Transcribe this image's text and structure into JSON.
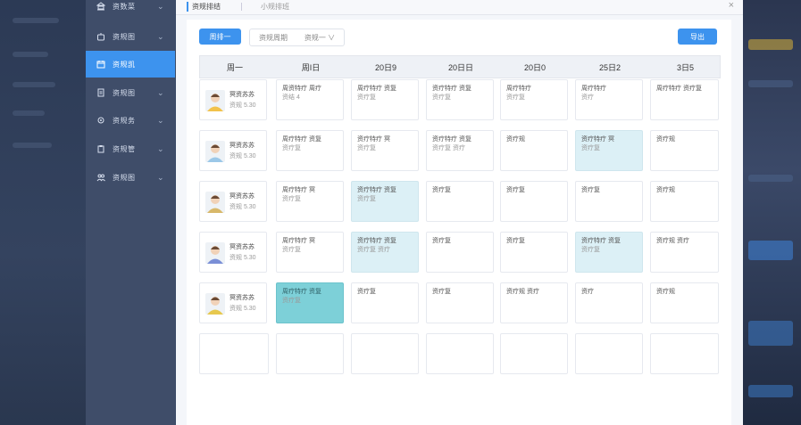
{
  "sidebar": {
    "items": [
      {
        "label": "资数菜",
        "icon": "bank-icon",
        "active": false
      },
      {
        "label": "资规图",
        "icon": "bot-icon",
        "active": false
      },
      {
        "label": "资规凯",
        "icon": "calendar-icon",
        "active": true
      },
      {
        "label": "资规图",
        "icon": "doc-icon",
        "active": false
      },
      {
        "label": "资规务",
        "icon": "settings-icon",
        "active": false
      },
      {
        "label": "资规管",
        "icon": "clipboard-icon",
        "active": false
      },
      {
        "label": "资规图",
        "icon": "people-icon",
        "active": false
      }
    ]
  },
  "topbar": {
    "tab_active": "资规排结",
    "tab_inactive": "小规排班",
    "close": "×"
  },
  "toolbar": {
    "week_button": "周排一",
    "seg_a": "资规周期",
    "seg_b": "资规一 ∨",
    "right_button": "导出"
  },
  "table": {
    "headers": [
      "周一",
      "周I日",
      "20日9",
      "20日日",
      "20日0",
      "25日2",
      "3日5"
    ],
    "rows": [
      {
        "person": {
          "name": "冥资苏苏",
          "meta": "资规 5.30",
          "avatar_color": "#f2c24b"
        },
        "cells": [
          {
            "l1": "周资特疗 周疗",
            "l2": "资结 4",
            "style": "plain"
          },
          {
            "l1": "周疗特疗 资复",
            "l2": "资疗复",
            "style": "plain"
          },
          {
            "l1": "资疗特疗 资复",
            "l2": "资疗复",
            "style": "plain"
          },
          {
            "l1": "周疗特疗",
            "l2": "资疗复",
            "style": "plain"
          },
          {
            "l1": "周疗特疗",
            "l2": "资疗",
            "style": "plain"
          },
          {
            "l1": "周疗特疗 资疗复",
            "l2": "",
            "style": "plain"
          }
        ]
      },
      {
        "person": {
          "name": "冥资苏苏",
          "meta": "资规 5.30",
          "avatar_color": "#9cc8e8"
        },
        "cells": [
          {
            "l1": "周疗特疗 资复",
            "l2": "资疗复",
            "style": "plain"
          },
          {
            "l1": "资疗特疗 冥",
            "l2": "资疗复",
            "style": "plain"
          },
          {
            "l1": "资疗特疗 资复",
            "l2": "资疗复 资疗",
            "style": "plain"
          },
          {
            "l1": "资疗规",
            "l2": "",
            "style": "plain"
          },
          {
            "l1": "资疗特疗 冥",
            "l2": "资疗复",
            "style": "blue"
          },
          {
            "l1": "资疗规",
            "l2": "",
            "style": "plain"
          }
        ]
      },
      {
        "person": {
          "name": "冥资苏苏",
          "meta": "资规 5.30",
          "avatar_color": "#d8b86a"
        },
        "cells": [
          {
            "l1": "周疗特疗 冥",
            "l2": "资疗复",
            "style": "plain"
          },
          {
            "l1": "资疗特疗 资复",
            "l2": "资疗复",
            "style": "blue"
          },
          {
            "l1": "资疗复",
            "l2": "",
            "style": "plain"
          },
          {
            "l1": "资疗复",
            "l2": "",
            "style": "plain"
          },
          {
            "l1": "资疗复",
            "l2": "",
            "style": "plain"
          },
          {
            "l1": "资疗规",
            "l2": "",
            "style": "plain"
          }
        ]
      },
      {
        "person": {
          "name": "冥资苏苏",
          "meta": "资规 5.30",
          "avatar_color": "#7a8fd6"
        },
        "cells": [
          {
            "l1": "周疗特疗 冥",
            "l2": "资疗复",
            "style": "plain"
          },
          {
            "l1": "资疗特疗 资复",
            "l2": "资疗复 资疗",
            "style": "blue"
          },
          {
            "l1": "资疗复",
            "l2": "",
            "style": "plain"
          },
          {
            "l1": "资疗复",
            "l2": "",
            "style": "plain"
          },
          {
            "l1": "资疗特疗 资复",
            "l2": "资疗复",
            "style": "blue"
          },
          {
            "l1": "资疗规 资疗",
            "l2": "",
            "style": "plain"
          }
        ]
      },
      {
        "person": {
          "name": "冥资苏苏",
          "meta": "资规 5.30",
          "avatar_color": "#e7c84e"
        },
        "cells": [
          {
            "l1": "周疗特疗 资复",
            "l2": "资疗复",
            "style": "teal"
          },
          {
            "l1": "资疗复",
            "l2": "",
            "style": "plain"
          },
          {
            "l1": "资疗复",
            "l2": "",
            "style": "plain"
          },
          {
            "l1": "资疗规 资疗",
            "l2": "",
            "style": "plain"
          },
          {
            "l1": "资疗",
            "l2": "",
            "style": "plain"
          },
          {
            "l1": "资疗规",
            "l2": "",
            "style": "plain"
          }
        ]
      }
    ]
  }
}
